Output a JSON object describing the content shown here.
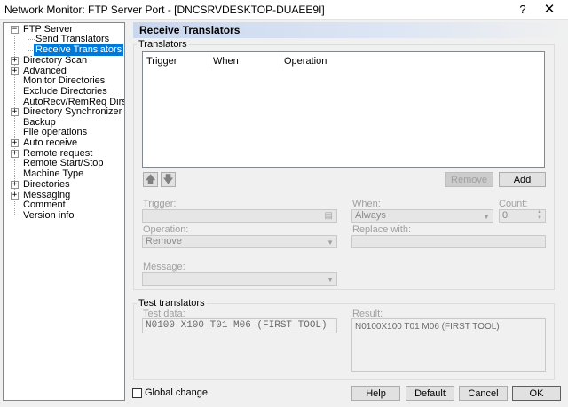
{
  "window": {
    "title": "Network Monitor: FTP Server Port - [DNCSRVDESKTOP-DUAEE9I]",
    "help_glyph": "?",
    "close_glyph": "✕"
  },
  "tree": {
    "items": [
      {
        "label": "FTP Server",
        "expander": "−"
      },
      {
        "label": "Send Translators"
      },
      {
        "label": "Receive Translators",
        "selected": true
      },
      {
        "label": "Directory Scan",
        "expander": "+"
      },
      {
        "label": "Advanced",
        "expander": "+"
      },
      {
        "label": "Monitor Directories"
      },
      {
        "label": "Exclude Directories"
      },
      {
        "label": "AutoRecv/RemReq Dirs."
      },
      {
        "label": "Directory Synchronizer",
        "expander": "+"
      },
      {
        "label": "Backup"
      },
      {
        "label": "File operations"
      },
      {
        "label": "Auto receive",
        "expander": "+"
      },
      {
        "label": "Remote request",
        "expander": "+"
      },
      {
        "label": "Remote Start/Stop"
      },
      {
        "label": "Machine Type"
      },
      {
        "label": "Directories",
        "expander": "+"
      },
      {
        "label": "Messaging",
        "expander": "+"
      },
      {
        "label": "Comment"
      },
      {
        "label": "Version info"
      }
    ]
  },
  "panel": {
    "title": "Receive Translators",
    "translators_group": "Translators",
    "columns": [
      "Trigger",
      "When",
      "Operation"
    ],
    "remove_label": "Remove",
    "add_label": "Add",
    "trigger_label": "Trigger:",
    "trigger_value": "",
    "when_label": "When:",
    "when_value": "Always",
    "count_label": "Count:",
    "count_value": "0",
    "operation_label": "Operation:",
    "operation_value": "Remove",
    "replace_label": "Replace with:",
    "replace_value": "",
    "message_label": "Message:",
    "message_value": ""
  },
  "test": {
    "group_label": "Test translators",
    "test_data_label": "Test data:",
    "test_data_value": "N0100 X100 T01 M06 (FIRST TOOL)",
    "result_label": "Result:",
    "result_value": "N0100X100 T01 M06 (FIRST TOOL)"
  },
  "footer": {
    "global_change_label": "Global change",
    "global_change_checked": false,
    "help_label": "Help",
    "default_label": "Default",
    "cancel_label": "Cancel",
    "ok_label": "OK"
  }
}
